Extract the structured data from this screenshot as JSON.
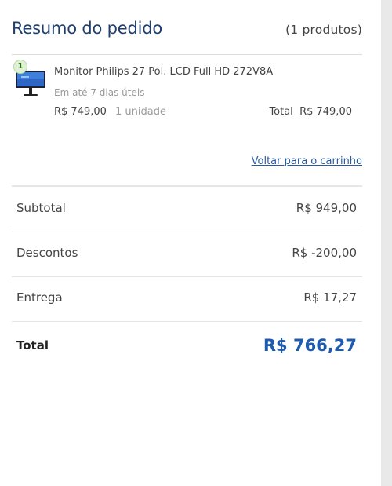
{
  "summary": {
    "title": "Resumo do pedido",
    "product_count": "(1 produtos)"
  },
  "item": {
    "quantity_badge": "1",
    "icon": "monitor-thumbnail",
    "name": "Monitor Philips 27 Pol. LCD Full HD 272V8A",
    "delivery": "Em até 7 dias úteis",
    "unit_price": "R$ 749,00",
    "units": "1 unidade",
    "total": "Total  R$ 749,00"
  },
  "back_to_cart": "Voltar para o carrinho",
  "totals": {
    "subtotal_label": "Subtotal",
    "subtotal_value": "R$ 949,00",
    "discounts_label": "Descontos",
    "discounts_value": "R$ -200,00",
    "shipping_label": "Entrega",
    "shipping_value": "R$ 17,27",
    "total_label": "Total",
    "total_value": "R$ 766,27"
  },
  "colors": {
    "title": "#1f3f6e",
    "link": "#2a5ba0",
    "total_value": "#1e5bb0",
    "badge_bg": "#dff0d4"
  }
}
